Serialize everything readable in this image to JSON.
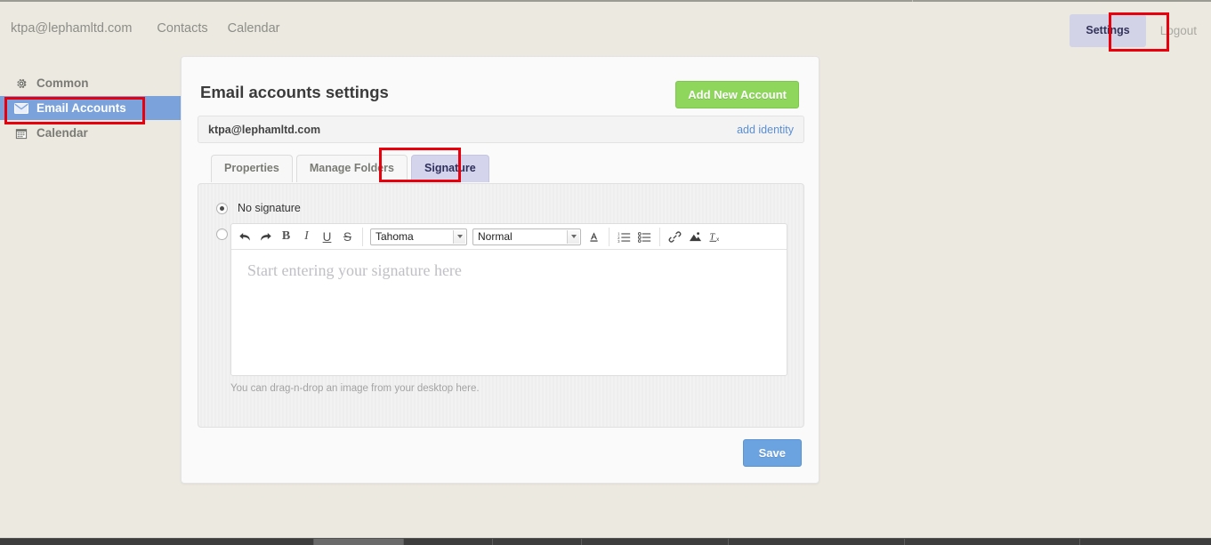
{
  "topnav": {
    "items": [
      {
        "label": "ktpa@lephamltd.com",
        "name": "topnav-account"
      },
      {
        "label": "Contacts",
        "name": "topnav-contacts"
      },
      {
        "label": "Calendar",
        "name": "topnav-calendar"
      }
    ],
    "settings_label": "Settings",
    "logout_label": "Logout"
  },
  "sidebar": {
    "items": [
      {
        "label": "Common",
        "icon": "gear-icon",
        "active": false
      },
      {
        "label": "Email Accounts",
        "icon": "envelope-icon",
        "active": true
      },
      {
        "label": "Calendar",
        "icon": "calendar-icon",
        "active": false
      }
    ]
  },
  "card": {
    "title": "Email accounts settings",
    "add_account_label": "Add New Account",
    "account": {
      "email": "ktpa@lephamltd.com",
      "add_identity_label": "add identity"
    },
    "tabs": [
      {
        "label": "Properties",
        "active": false
      },
      {
        "label": "Manage Folders",
        "active": false
      },
      {
        "label": "Signature",
        "active": true
      }
    ],
    "signature": {
      "no_signature_label": "No signature",
      "no_signature_selected": true,
      "custom_signature_selected": false,
      "editor": {
        "placeholder": "Start entering your signature here",
        "value": "",
        "font_family": "Tahoma",
        "font_size": "Normal",
        "toolbar": [
          {
            "name": "undo-icon",
            "glyph": "↶"
          },
          {
            "name": "redo-icon",
            "glyph": "↷"
          },
          {
            "name": "bold-icon",
            "glyph": "B"
          },
          {
            "name": "italic-icon",
            "glyph": "I"
          },
          {
            "name": "underline-icon",
            "glyph": "U"
          },
          {
            "name": "strikethrough-icon",
            "glyph": "S"
          },
          {
            "name": "font-color-icon",
            "glyph": "A"
          },
          {
            "name": "ordered-list-icon",
            "glyph": "≡"
          },
          {
            "name": "unordered-list-icon",
            "glyph": "≡"
          },
          {
            "name": "insert-link-icon",
            "glyph": "⛓"
          },
          {
            "name": "insert-image-icon",
            "glyph": "⛰"
          },
          {
            "name": "clear-format-icon",
            "glyph": "Tx"
          }
        ]
      },
      "drop_hint": "You can drag-n-drop an image from your desktop here."
    },
    "save_label": "Save"
  },
  "colors": {
    "page_background": "#ece9e1",
    "sidebar_active": "#7ba2db",
    "tab_active": "#d4d4ec",
    "settings_active": "#d3d3e8",
    "add_account_green": "#8ed65c",
    "save_blue": "#6ba3e0",
    "link_blue": "#5b8fd4",
    "annotation_red": "#e8000d"
  }
}
